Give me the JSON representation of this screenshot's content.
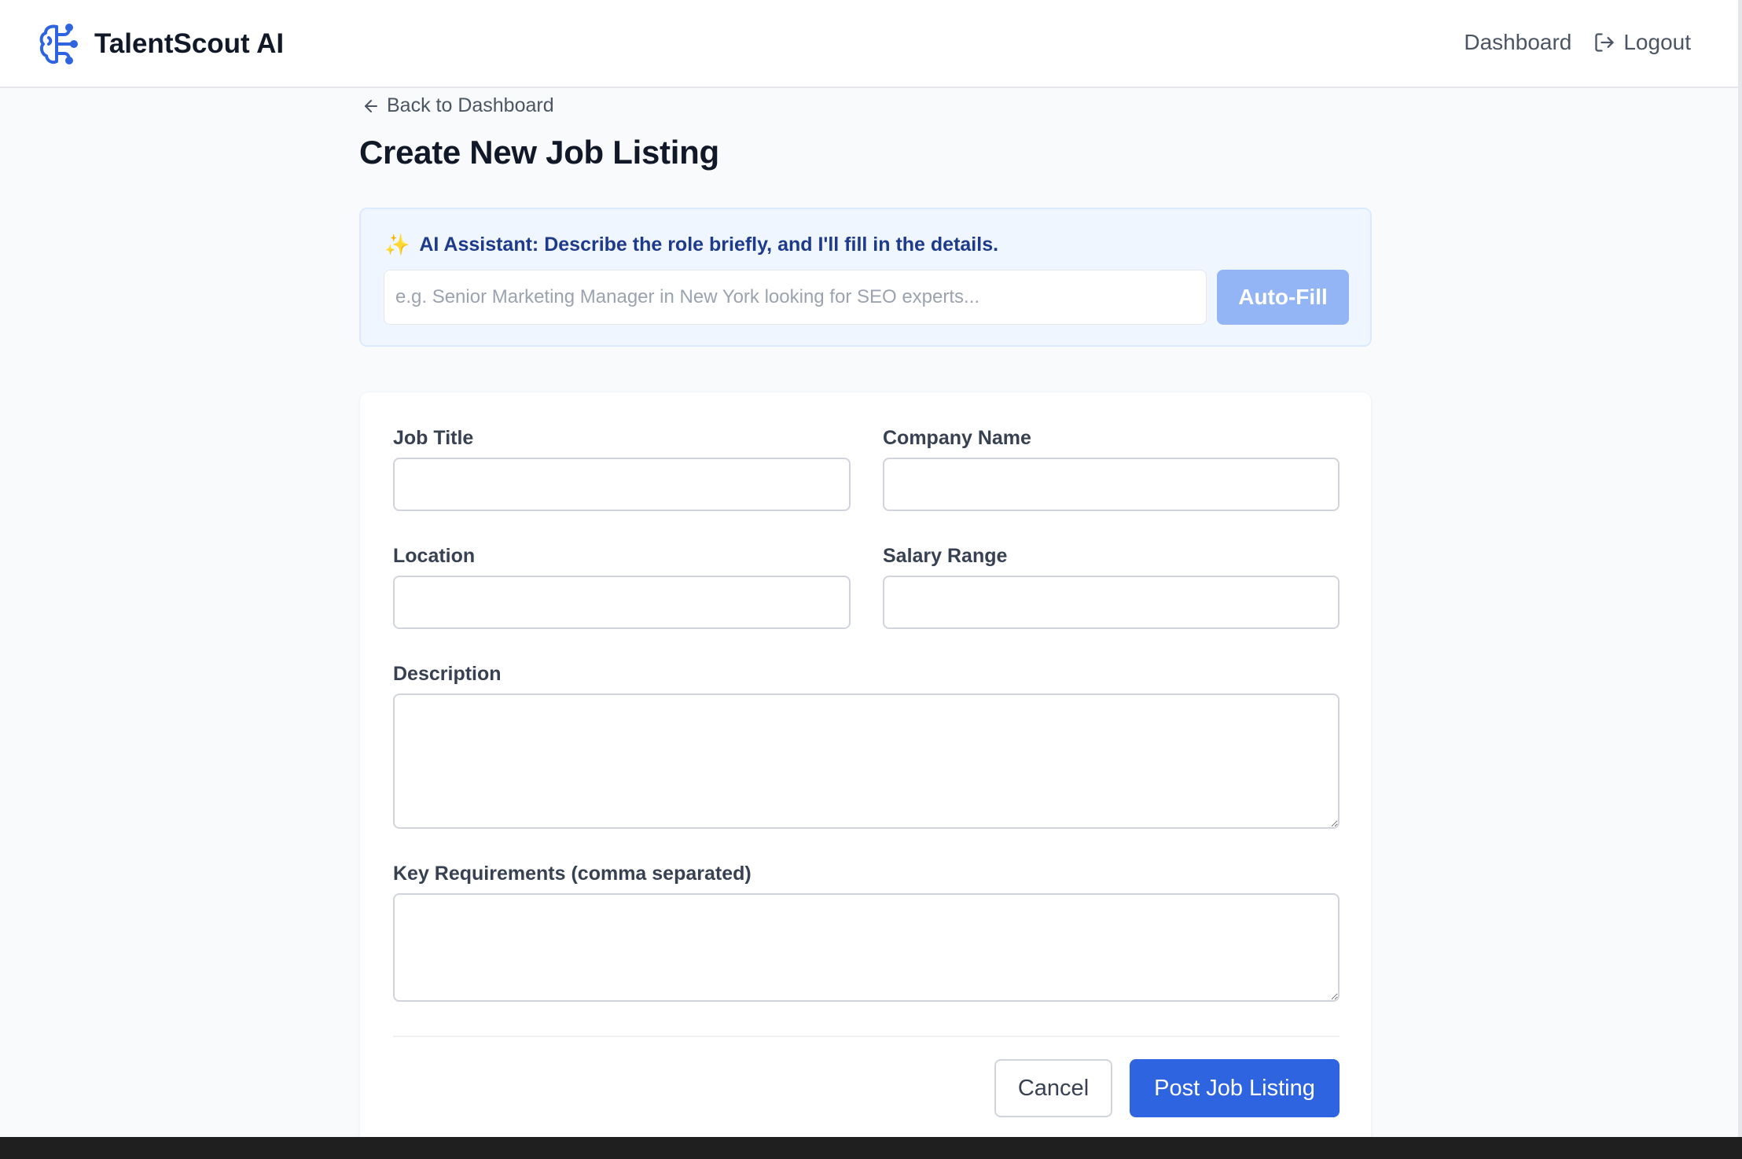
{
  "header": {
    "brand_name": "TalentScout AI",
    "nav_dashboard": "Dashboard",
    "nav_logout": "Logout"
  },
  "back_link": "Back to Dashboard",
  "page_title": "Create New Job Listing",
  "ai_assistant": {
    "sparkle": "✨",
    "label": "AI Assistant: Describe the role briefly, and I'll fill in the details.",
    "input_value": "",
    "input_placeholder": "e.g. Senior Marketing Manager in New York looking for SEO experts...",
    "button_label": "Auto-Fill"
  },
  "form": {
    "job_title": {
      "label": "Job Title",
      "value": ""
    },
    "company_name": {
      "label": "Company Name",
      "value": ""
    },
    "location": {
      "label": "Location",
      "value": ""
    },
    "salary_range": {
      "label": "Salary Range",
      "value": ""
    },
    "description": {
      "label": "Description",
      "value": ""
    },
    "key_requirements": {
      "label": "Key Requirements (comma separated)",
      "value": ""
    },
    "cancel_label": "Cancel",
    "submit_label": "Post Job Listing"
  },
  "colors": {
    "brand_icon": "#2f64e0",
    "primary_button": "#2f64e0",
    "autofill_button": "#93b4f5",
    "ai_panel_bg": "#eff6ff",
    "ai_text": "#1e3a8a"
  },
  "icons": {
    "brand": "brain-circuit-icon",
    "logout": "logout-icon",
    "back": "arrow-left-icon",
    "ai": "sparkles-icon"
  }
}
